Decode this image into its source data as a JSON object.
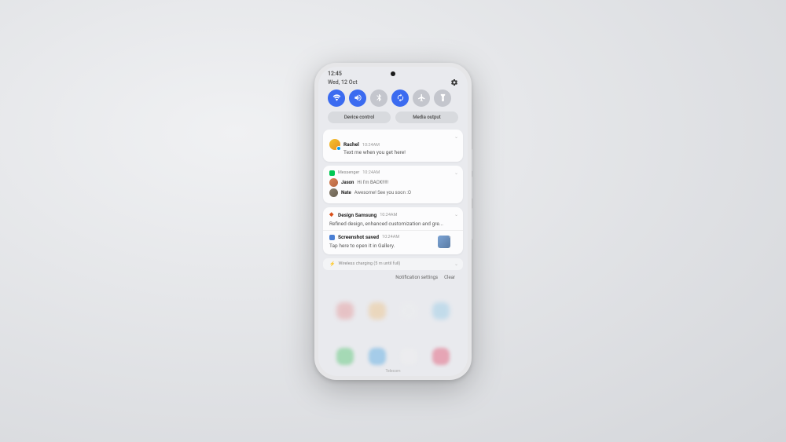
{
  "status": {
    "time": "12:45",
    "date": "Wed, 12 Oct"
  },
  "toggles": [
    {
      "name": "wifi",
      "active": true
    },
    {
      "name": "sound",
      "active": true
    },
    {
      "name": "bluetooth",
      "active": false
    },
    {
      "name": "rotate",
      "active": true
    },
    {
      "name": "airplane",
      "active": false
    },
    {
      "name": "flashlight",
      "active": false
    }
  ],
  "pills": {
    "device": "Device control",
    "media": "Media output"
  },
  "notif_rachel": {
    "name": "Rachel",
    "time": "10:24AM",
    "body": "Text me when you get here!"
  },
  "notif_messenger": {
    "app": "Messenger",
    "time": "10:24AM",
    "rows": [
      {
        "name": "Jason",
        "text": "Hi I'm BACK!!!!!"
      },
      {
        "name": "Nate",
        "text": "Awesome! See you soon :O"
      }
    ]
  },
  "notif_design": {
    "app": "Design Samsung",
    "time": "10:24AM",
    "body": "Refined design, enhanced customization and gre..."
  },
  "notif_screenshot": {
    "title": "Screenshot saved",
    "time": "10:24AM",
    "body": "Tap here to open it in Gallery."
  },
  "wireless": {
    "text": "Wireless charging (5 m until full)"
  },
  "footer": {
    "settings": "Notification settings",
    "clear": "Clear"
  },
  "carrier": "Telecom"
}
